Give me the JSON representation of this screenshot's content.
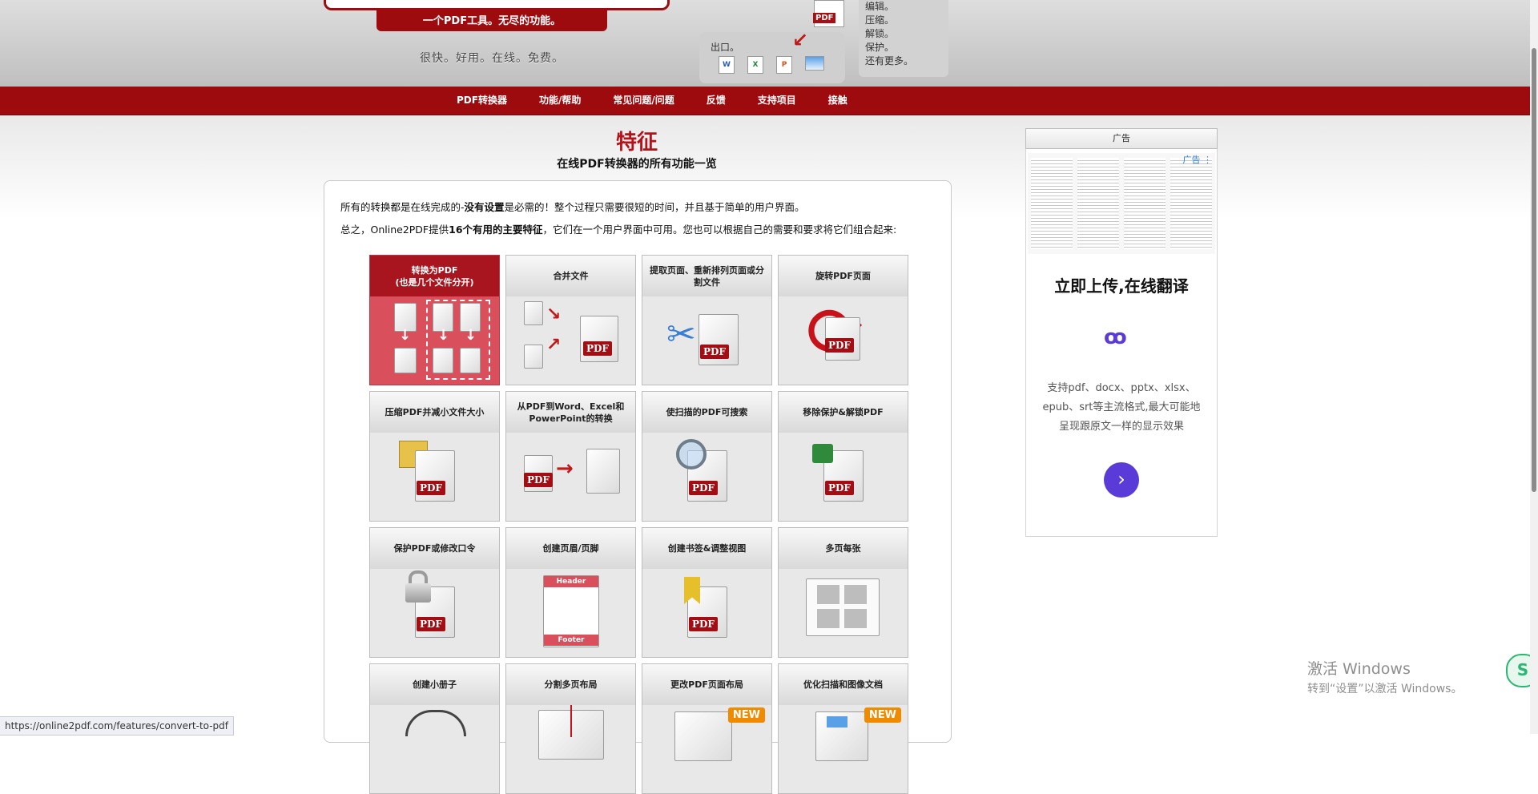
{
  "header": {
    "banner": "一个PDF工具。无尽的功能。",
    "slogan": "很快。好用。在线。免费。",
    "export_label": "出口。",
    "export_icons": [
      "word-doc-icon",
      "excel-doc-icon",
      "powerpoint-doc-icon",
      "image-icon"
    ],
    "pdf_badge": "PDF",
    "side_features": [
      "编辑。",
      "压缩。",
      "解锁。",
      "保护。",
      "还有更多。"
    ]
  },
  "nav": {
    "items": [
      "PDF转换器",
      "功能/帮助",
      "常见问题/问题",
      "反馈",
      "支持项目",
      "接触"
    ]
  },
  "main": {
    "title": "特征",
    "subtitle": "在线PDF转换器的所有功能一览",
    "intro1_a": "所有的转换都是在线完成的-",
    "intro1_b": "没有设置",
    "intro1_c": "是必需的！整个过程只需要很短的时间，并且基于简单的用户界面。",
    "intro2_a": "总之，Online2PDF提供",
    "intro2_b": "16个有用的主要特征",
    "intro2_c": "，它们在一个用户界面中可用。您也可以根据自己的需要和要求将它们组合起来:",
    "pdf_label": "PDF",
    "new_label": "NEW",
    "header_text": "Header",
    "footer_text": "Footer",
    "features": [
      {
        "label": "转换为PDF\n(也是几个文件分开)",
        "icon": "convert-to-pdf-icon",
        "active": true
      },
      {
        "label": "合并文件",
        "icon": "merge-files-icon"
      },
      {
        "label": "提取页面、重新排列页面或分割文件",
        "icon": "scissors-icon"
      },
      {
        "label": "旋转PDF页面",
        "icon": "rotate-icon"
      },
      {
        "label": "压缩PDF并减小文件大小",
        "icon": "compress-icon"
      },
      {
        "label": "从PDF到Word、Excel和PowerPoint的转换",
        "icon": "pdf-to-office-icon"
      },
      {
        "label": "使扫描的PDF可搜索",
        "icon": "magnifier-icon"
      },
      {
        "label": "移除保护&解锁PDF",
        "icon": "unlock-icon"
      },
      {
        "label": "保护PDF或修改口令",
        "icon": "padlock-icon"
      },
      {
        "label": "创建页眉/页脚",
        "icon": "header-footer-icon"
      },
      {
        "label": "创建书签&调整视图",
        "icon": "bookmark-icon"
      },
      {
        "label": "多页每张",
        "icon": "multi-page-icon"
      },
      {
        "label": "创建小册子",
        "icon": "booklet-icon"
      },
      {
        "label": "分割多页布局",
        "icon": "split-layout-icon"
      },
      {
        "label": "更改PDF页面布局",
        "icon": "page-layout-icon",
        "badge": true
      },
      {
        "label": "优化扫描和图像文档",
        "icon": "optimize-scan-icon",
        "badge": true
      }
    ]
  },
  "ad": {
    "label": "广告",
    "corner": "广告 ⋮",
    "title": "立即上传,在线翻译",
    "link_glyph": "ꝏ",
    "description": "支持pdf、docx、pptx、xlsx、epub、srt等主流格式,最大可能地呈现跟原文一样的显示效果",
    "button_glyph": "›"
  },
  "windows": {
    "activate_title": "激活 Windows",
    "activate_sub": "转到“设置”以激活 Windows。"
  },
  "status_url": "https://online2pdf.com/features/convert-to-pdf",
  "colors": {
    "brand_red": "#9e0b0f",
    "tile_active": "#d9505c",
    "ad_purple": "#5b3bd8",
    "new_orange": "#f08a00"
  }
}
